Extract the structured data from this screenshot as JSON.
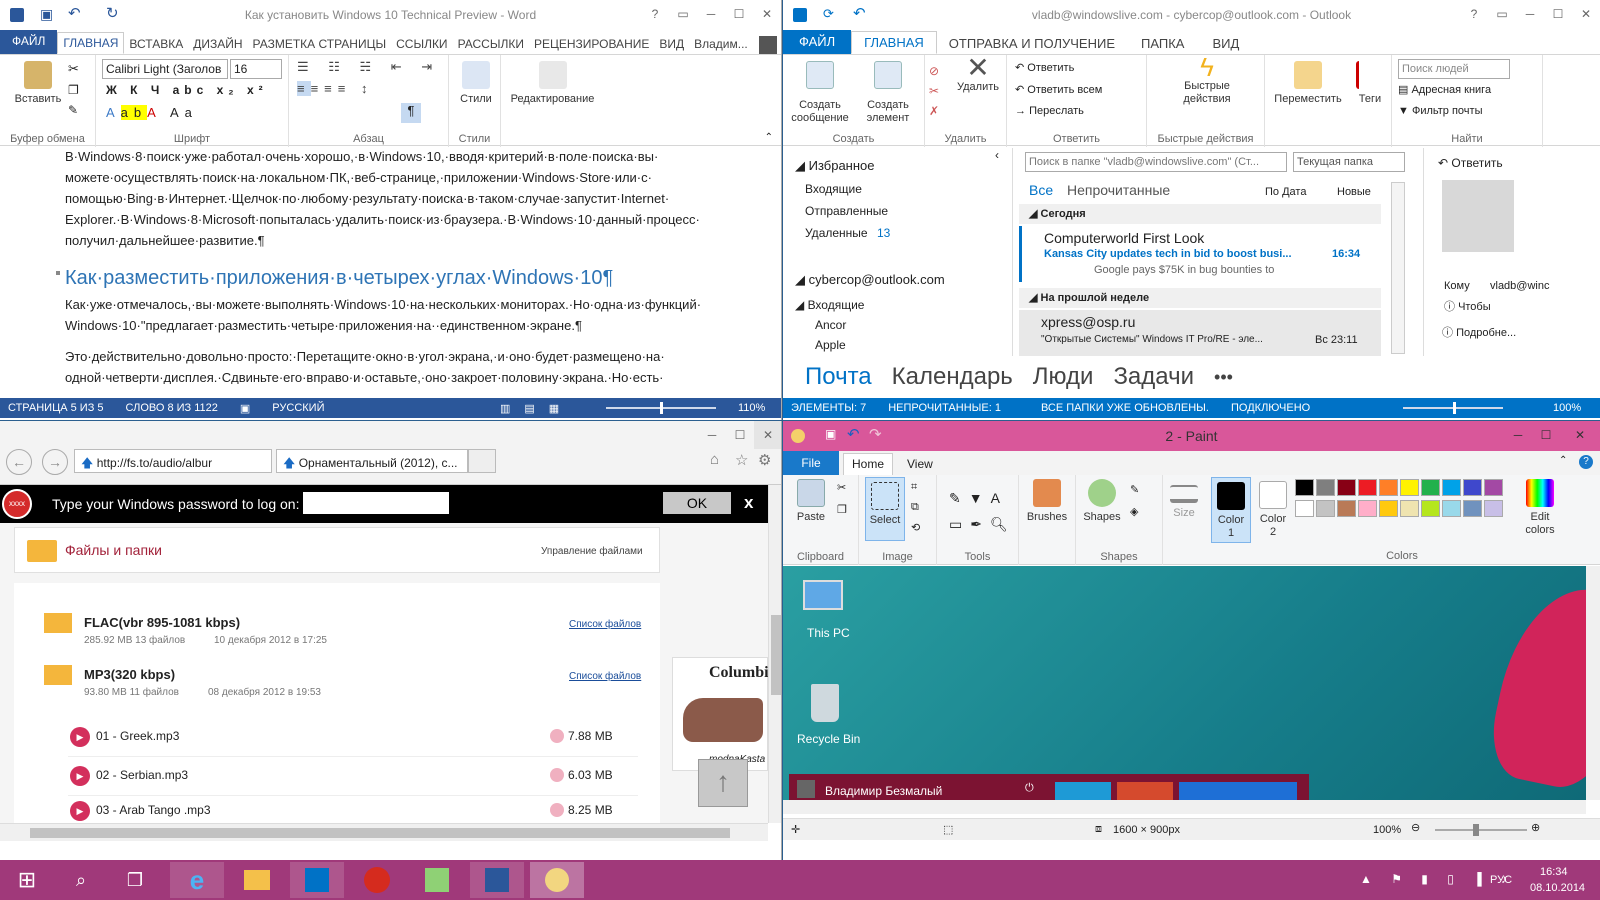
{
  "word": {
    "title": "Как установить Windows 10 Technical Preview - Word",
    "tabs": [
      "ФАЙЛ",
      "ГЛАВНАЯ",
      "ВСТАВКА",
      "ДИЗАЙН",
      "РАЗМЕТКА СТРАНИЦЫ",
      "ССЫЛКИ",
      "РАССЫЛКИ",
      "РЕЦЕНЗИРОВАНИЕ",
      "ВИД"
    ],
    "user": "Владим...",
    "paste": "Вставить",
    "font": "Calibri Light (Заголов",
    "size": "16",
    "styles": "Стили",
    "edit": "Редактирование",
    "groups": [
      "Буфер обмена",
      "Шрифт",
      "Абзац",
      "Стили"
    ],
    "p1": "В·Windows·8·поиск·уже·работал·очень·хорошо,·в·Windows·10,·вводя·критерий·в·поле·поиска·вы· можете·осуществлять·поиск·на·локальном·ПК,·веб-странице,·приложении·Windows·Store·или·с· помощью·Bing·в·Интернет.·Щелчок·по·любому·результату·поиска·в·таком·случае·запустит·Internet· Explorer.·В·Windows·8·Microsoft·попыталась·удалить·поиск·из·браузера.·В·Windows·10·данный·процесс· получил·дальнейшее·развитие.¶",
    "heading": "Как·разместить·приложения·в·четырех·углах·Windows·10¶",
    "p2": "Как·уже·отмечалось,·вы·можете·выполнять·Windows·10·на·нескольких·мониторах.·Но·одна·из·функций· Windows·10·\"предлагает·разместить·четыре·приложения·на··единственном·экране.¶",
    "p3": "Это·действительно·довольно·просто:·Перетащите·окно·в·угол·экрана,·и·оно·будет·размещено·на· одной·четверти·дисплея.·Сдвиньте·его·вправо·и·оставьте,·оно·закроет·половину·экрана.·Но·есть·",
    "status": [
      "СТРАНИЦА 5 ИЗ 5",
      "СЛОВО 8 ИЗ 1122",
      "РУССКИЙ"
    ],
    "zoom": "110%"
  },
  "outlook": {
    "title": "vladb@windowslive.com - cybercop@outlook.com - Outlook",
    "tabs": [
      "ФАЙЛ",
      "ГЛАВНАЯ",
      "ОТПРАВКА И ПОЛУЧЕНИЕ",
      "ПАПКА",
      "ВИД"
    ],
    "btns": {
      "new_mail": "Создать сообщение",
      "new_item": "Создать элемент",
      "delete": "Удалить",
      "reply": "Ответить",
      "reply_all": "Ответить всем",
      "forward": "Переслать",
      "quick": "Быстрые действия",
      "move": "Переместить",
      "tags": "Теги",
      "people_search": "Поиск людей",
      "address_book": "Адресная книга",
      "filter": "Фильтр почты"
    },
    "groups": [
      "Создать",
      "Удалить",
      "Ответить",
      "Быстрые действия",
      "Найти"
    ],
    "fav": "Избранное",
    "folders": [
      "Входящие",
      "Отправленные",
      "Удаленные"
    ],
    "deleted_count": "13",
    "account": "cybercop@outlook.com",
    "acc_inbox": "Входящие",
    "acc_sub": [
      "Ancor",
      "Apple"
    ],
    "search": "Поиск в папке \"vladb@windowslive.com\" (Ст...",
    "scope": "Текущая папка",
    "filter_all": "Все",
    "filter_unread": "Непрочитанные",
    "sort": "По Дата",
    "order": "Новые",
    "today": "Сегодня",
    "m1": {
      "from": "Computerworld First Look",
      "subj": "Kansas City updates tech in bid to boost busi...",
      "time": "16:34",
      "prev": "Google pays $75K in bug bounties to"
    },
    "lastweek": "На прошлой неделе",
    "m2": {
      "from": "xpress@osp.ru",
      "subj": "\"Открытые Системы\" Windows IT Pro/RE - эле...",
      "time": "Вс 23:11"
    },
    "reply2": "Ответить",
    "to": "Кому",
    "to_val": "vladb@winc",
    "info": "Чтобы",
    "more": "Подробне...",
    "nav": [
      "Почта",
      "Календарь",
      "Люди",
      "Задачи",
      "•••"
    ],
    "status": [
      "ЭЛЕМЕНТЫ: 7",
      "НЕПРОЧИТАННЫЕ: 1",
      "ВСЕ ПАПКИ УЖЕ ОБНОВЛЕНЫ.",
      "ПОДКЛЮЧЕНО"
    ],
    "zoom": "100%"
  },
  "ie": {
    "url": "http://fs.to/audio/albur",
    "tab": "Орнаментальный (2012), с...",
    "pwd_prompt": "Type your Windows password to log on:",
    "ok": "OK",
    "x": "x",
    "files": "Файлы и папки",
    "manage": "Управление файлами",
    "folders": [
      {
        "name": "FLAC(vbr 895-1081 kbps)",
        "size": "285.92 MB 13 файлов",
        "date": "10 декабря 2012 в 17:25",
        "link": "Список файлов"
      },
      {
        "name": "MP3(320 kbps)",
        "size": "93.80 MB 11 файлов",
        "date": "08 декабря 2012 в 19:53",
        "link": "Список файлов"
      }
    ],
    "tracks": [
      {
        "name": "01 - Greek.mp3",
        "size": "7.88 MB"
      },
      {
        "name": "02 - Serbian.mp3",
        "size": "6.03 MB"
      },
      {
        "name": "03 - Arab Tango .mp3",
        "size": "8.25 MB"
      }
    ],
    "ad": "Columbia",
    "ad2": "modnaKasta"
  },
  "paint": {
    "title": "2 - Paint",
    "tabs": [
      "File",
      "Home",
      "View"
    ],
    "btns": {
      "paste": "Paste",
      "select": "Select",
      "brushes": "Brushes",
      "shapes": "Shapes",
      "size": "Size",
      "color1": "Color 1",
      "color2": "Color 2",
      "edit": "Edit colors"
    },
    "groups": [
      "Clipboard",
      "Image",
      "Tools",
      "Shapes",
      "Colors"
    ],
    "palette": [
      "#000000",
      "#7f7f7f",
      "#880015",
      "#ed1c24",
      "#ff7f27",
      "#fff200",
      "#22b14c",
      "#00a2e8",
      "#3f48cc",
      "#a349a4",
      "#ffffff",
      "#c3c3c3",
      "#b97a57",
      "#ffaec9",
      "#ffc90e",
      "#efe4b0",
      "#b5e61d",
      "#99d9ea",
      "#7092be",
      "#c8bfe7"
    ],
    "desk": [
      "This PC",
      "Recycle Bin"
    ],
    "user": "Владимир Безмалый",
    "dims": "1600 × 900px",
    "zoom": "100%"
  },
  "taskbar": {
    "lang": "РУС",
    "time": "16:34",
    "date": "08.10.2014"
  }
}
